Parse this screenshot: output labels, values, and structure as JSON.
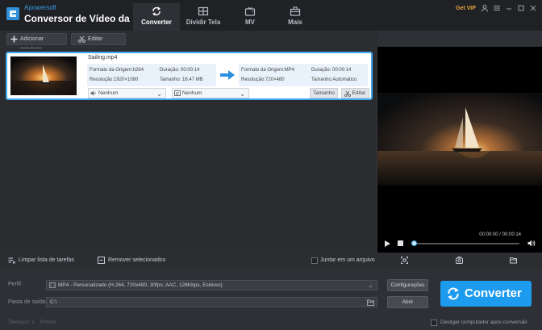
{
  "app": {
    "brand": "Apowersoft",
    "name": "Conversor de Vídeo da",
    "get_vip": "Get VIP",
    "accent": "#1d9bef"
  },
  "tabs": [
    {
      "label": "Converter",
      "icon": "refresh-icon",
      "active": true
    },
    {
      "label": "Dividir Tela",
      "icon": "split-screen-icon",
      "active": false
    },
    {
      "label": "MV",
      "icon": "tv-icon",
      "active": false
    },
    {
      "label": "Mais",
      "icon": "toolbox-icon",
      "active": false
    }
  ],
  "toolbar": {
    "add_files": "Adicionar arquivos",
    "edit": "Editar"
  },
  "file": {
    "name": "Sailing.mp4",
    "source": {
      "format": "Formato da Origem:h264",
      "duration": "Duração: 00:00:14",
      "resolution": "Resolução:1920×1080",
      "size": "Tamanho: 16.47 MB"
    },
    "target": {
      "format": "Formato da Origem:MP4",
      "duration": "Duração: 00:00:14",
      "resolution": "Resolução:720×480",
      "size": "Tamanho:Automático"
    },
    "audio_track": "Nenhum",
    "subtitle": "Nenhum",
    "size_btn": "Tamanho",
    "edit_btn": "Editar"
  },
  "preview": {
    "time": "00:00:00 / 00:00:14",
    "progress": 0
  },
  "actions": {
    "clear_list": "Limpar lista de tarefas",
    "remove_selected": "Remover selecionados",
    "merge": "Juntar em um arquivo"
  },
  "settings": {
    "profile_label": "Perfil",
    "profile_value": "MP4 - Personalizado (H.264, 720x480, 30fps; AAC, 128Kbps, Estéreo)",
    "output_label": "Pasta de saída",
    "output_value": "C:\\",
    "config_btn": "Configurações",
    "open_btn": "Abrir",
    "convert_btn": "Converter",
    "shutdown": "Desligar computador após conversão"
  },
  "status": {
    "tasks": "Tarefa(s): 1",
    "ready": "Pronto"
  }
}
